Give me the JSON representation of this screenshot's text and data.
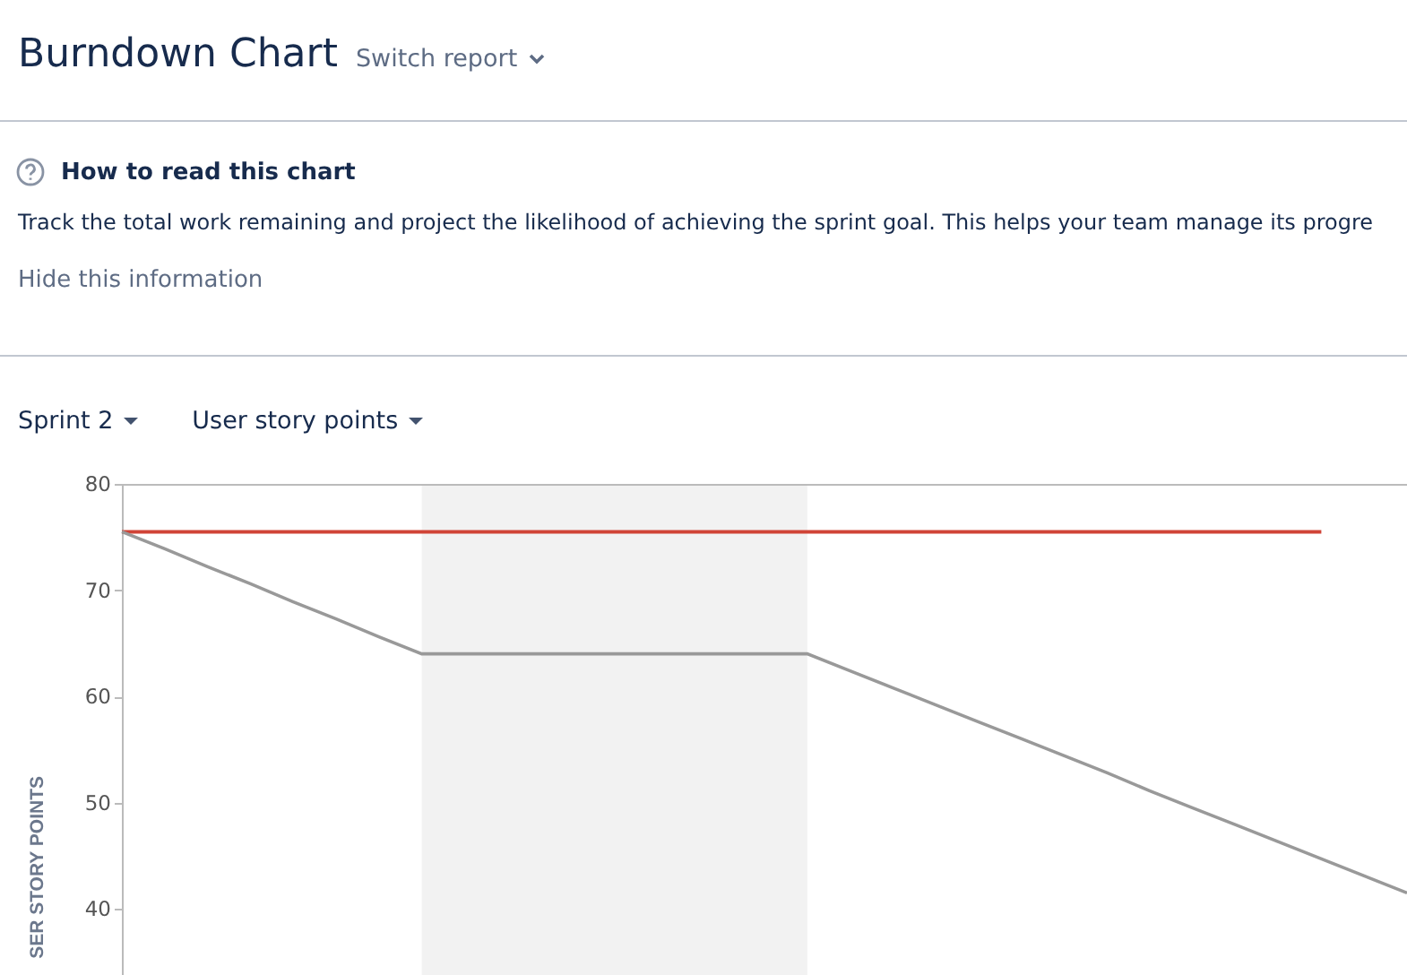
{
  "header": {
    "title": "Burndown Chart",
    "switch_report": "Switch report"
  },
  "help": {
    "title": "How to read this chart",
    "text": "Track the total work remaining and project the likelihood of achieving the sprint goal. This helps your team manage its progre",
    "hide_link": "Hide this information"
  },
  "selectors": [
    {
      "label": "Sprint 2"
    },
    {
      "label": "User story points"
    }
  ],
  "chart": {
    "chart_data": {
      "type": "line",
      "ylabel": "SER STORY POINTS",
      "categories": [
        null,
        null,
        null,
        null,
        null,
        null,
        null,
        null,
        null,
        null,
        null,
        null,
        null,
        null,
        null,
        null,
        null,
        null,
        null,
        null,
        null,
        null,
        null,
        null,
        null,
        null,
        null,
        null,
        null,
        null,
        null
      ],
      "ylim": [
        33.6,
        80
      ],
      "yticks": [
        40,
        50,
        60,
        70,
        80
      ],
      "series": [
        {
          "color": "#d04437",
          "values": [
            75.5,
            75.5,
            75.5,
            75.5,
            75.5,
            75.5,
            75.5,
            75.5,
            75.5,
            75.5,
            75.5,
            75.5,
            75.5,
            75.5,
            75.5,
            75.5,
            75.5,
            75.5,
            75.5,
            75.5,
            75.5,
            75.5,
            75.5,
            75.5,
            75.5,
            75.5,
            75.5,
            75.5,
            75.5,
            null,
            null
          ]
        },
        {
          "color": "#999999",
          "values": [
            75.5,
            73.9,
            72.2,
            70.6,
            68.9,
            67.3,
            65.6,
            64,
            64,
            64,
            64,
            64,
            64,
            64,
            64,
            64,
            64,
            62.4,
            60.8,
            59.2,
            57.6,
            56,
            54.4,
            52.8,
            51.1,
            49.5,
            47.9,
            46.3,
            44.7,
            43.1,
            41.5
          ]
        }
      ]
    }
  }
}
